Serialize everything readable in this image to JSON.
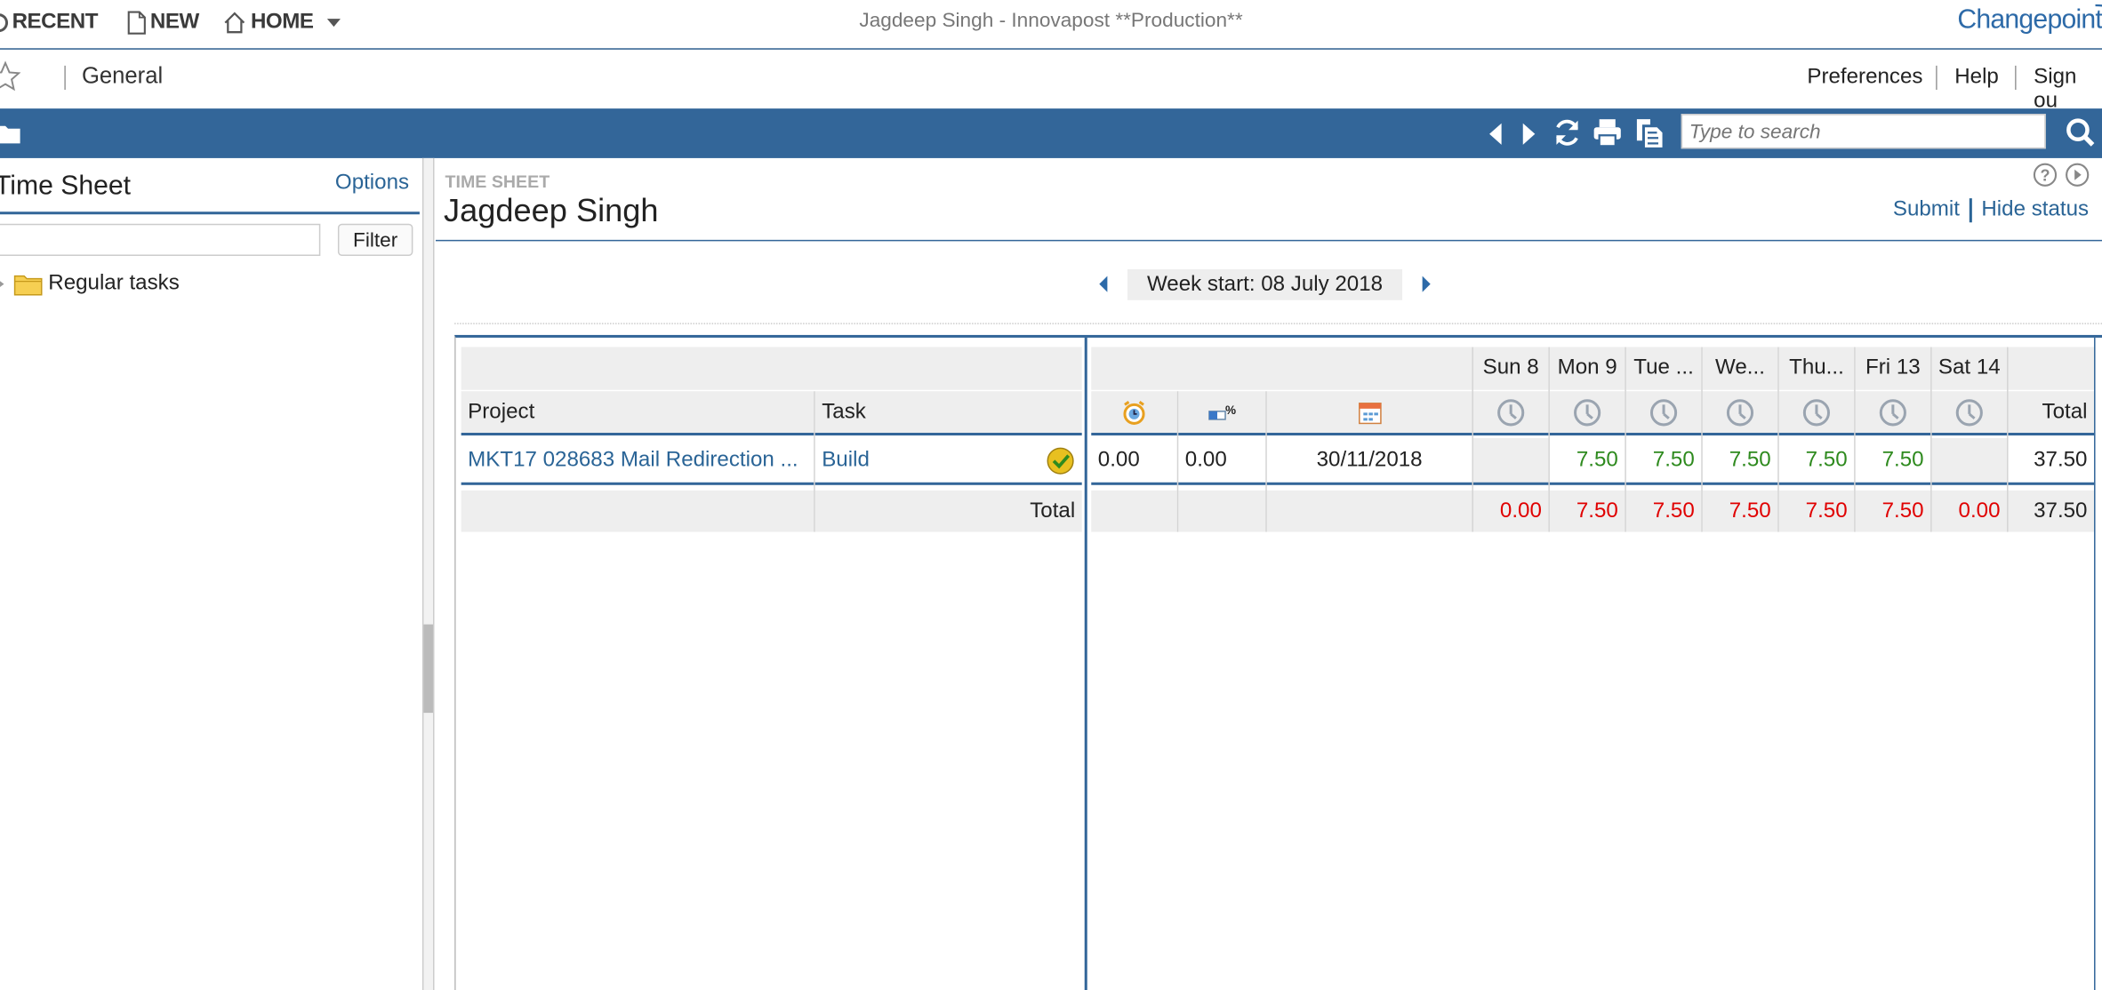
{
  "topbar": {
    "recent_label": "RECENT",
    "new_label": "NEW",
    "home_label": "HOME",
    "window_title": "Jagdeep Singh - Innovapost **Production**",
    "logo_text": "Changepoint"
  },
  "secondary": {
    "breadcrumb": "General",
    "links": [
      "Preferences",
      "Help",
      "Sign ou"
    ]
  },
  "toolbar": {
    "search_placeholder": "Type to search",
    "icons": [
      "folder-icon",
      "back-icon",
      "forward-icon",
      "refresh-icon",
      "print-icon",
      "copy-icon",
      "search-icon"
    ]
  },
  "left_panel": {
    "title": "Time Sheet",
    "options_label": "Options",
    "filter_value": "",
    "filter_button": "Filter",
    "tree_items": [
      "Regular tasks"
    ]
  },
  "main": {
    "section_label": "TIME SHEET",
    "person_name": "Jagdeep Singh",
    "submit_label": "Submit",
    "hide_status_label": "Hide status",
    "week_label": "Week start: 08 July 2018"
  },
  "grid": {
    "columns": {
      "project": "Project",
      "task": "Task",
      "days": [
        "Sun 8",
        "Mon 9",
        "Tue ...",
        "We...",
        "Thu...",
        "Fri 13",
        "Sat 14"
      ],
      "total": "Total"
    },
    "row": {
      "project": "MKT17 028683 Mail Redirection ...",
      "task": "Build",
      "val1": "0.00",
      "val2": "0.00",
      "date": "30/11/2018",
      "days": [
        "",
        "7.50",
        "7.50",
        "7.50",
        "7.50",
        "7.50",
        ""
      ],
      "total": "37.50"
    },
    "totals": {
      "label": "Total",
      "days": [
        "0.00",
        "7.50",
        "7.50",
        "7.50",
        "7.50",
        "7.50",
        "0.00"
      ],
      "total": "37.50"
    }
  },
  "colors": {
    "accent": "#336699",
    "link": "#2a6496",
    "hours_green": "#2e8a1e",
    "totals_red": "#e00000"
  }
}
